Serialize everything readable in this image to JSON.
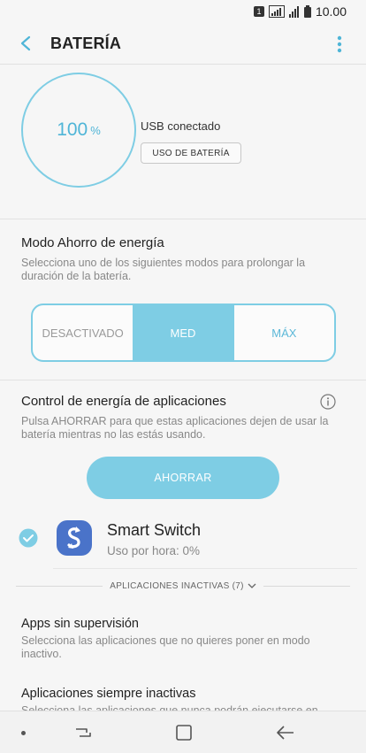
{
  "status_bar": {
    "sim": "1",
    "time": "10.00"
  },
  "header": {
    "title": "BATERÍA"
  },
  "battery": {
    "percent": "100",
    "percent_sign": "%",
    "usb_status": "USB conectado",
    "usage_button": "USO DE BATERÍA"
  },
  "power_mode": {
    "title": "Modo Ahorro de energía",
    "description": "Selecciona uno de los siguientes modos para prolongar la duración de la batería.",
    "options": [
      "DESACTIVADO",
      "MED",
      "MÁX"
    ],
    "selected": "MED"
  },
  "app_power": {
    "title": "Control de energía de aplicaciones",
    "description": "Pulsa AHORRAR para que estas aplicaciones dejen de usar la batería mientras no las estás usando.",
    "save_button": "AHORRAR",
    "apps": [
      {
        "name": "Smart Switch",
        "usage": "Uso por hora: 0%"
      }
    ]
  },
  "inactive": {
    "label": "APLICACIONES INACTIVAS (7)"
  },
  "list": [
    {
      "title": "Apps sin supervisión",
      "description": "Selecciona las aplicaciones que no quieres poner en modo inactivo."
    },
    {
      "title": "Aplicaciones siempre inactivas",
      "description": "Selecciona las aplicaciones que nunca podrán ejecutarse en"
    }
  ],
  "colors": {
    "accent": "#7ecde4",
    "accent_text": "#4fb5d7",
    "app_icon": "#4a73c9"
  }
}
